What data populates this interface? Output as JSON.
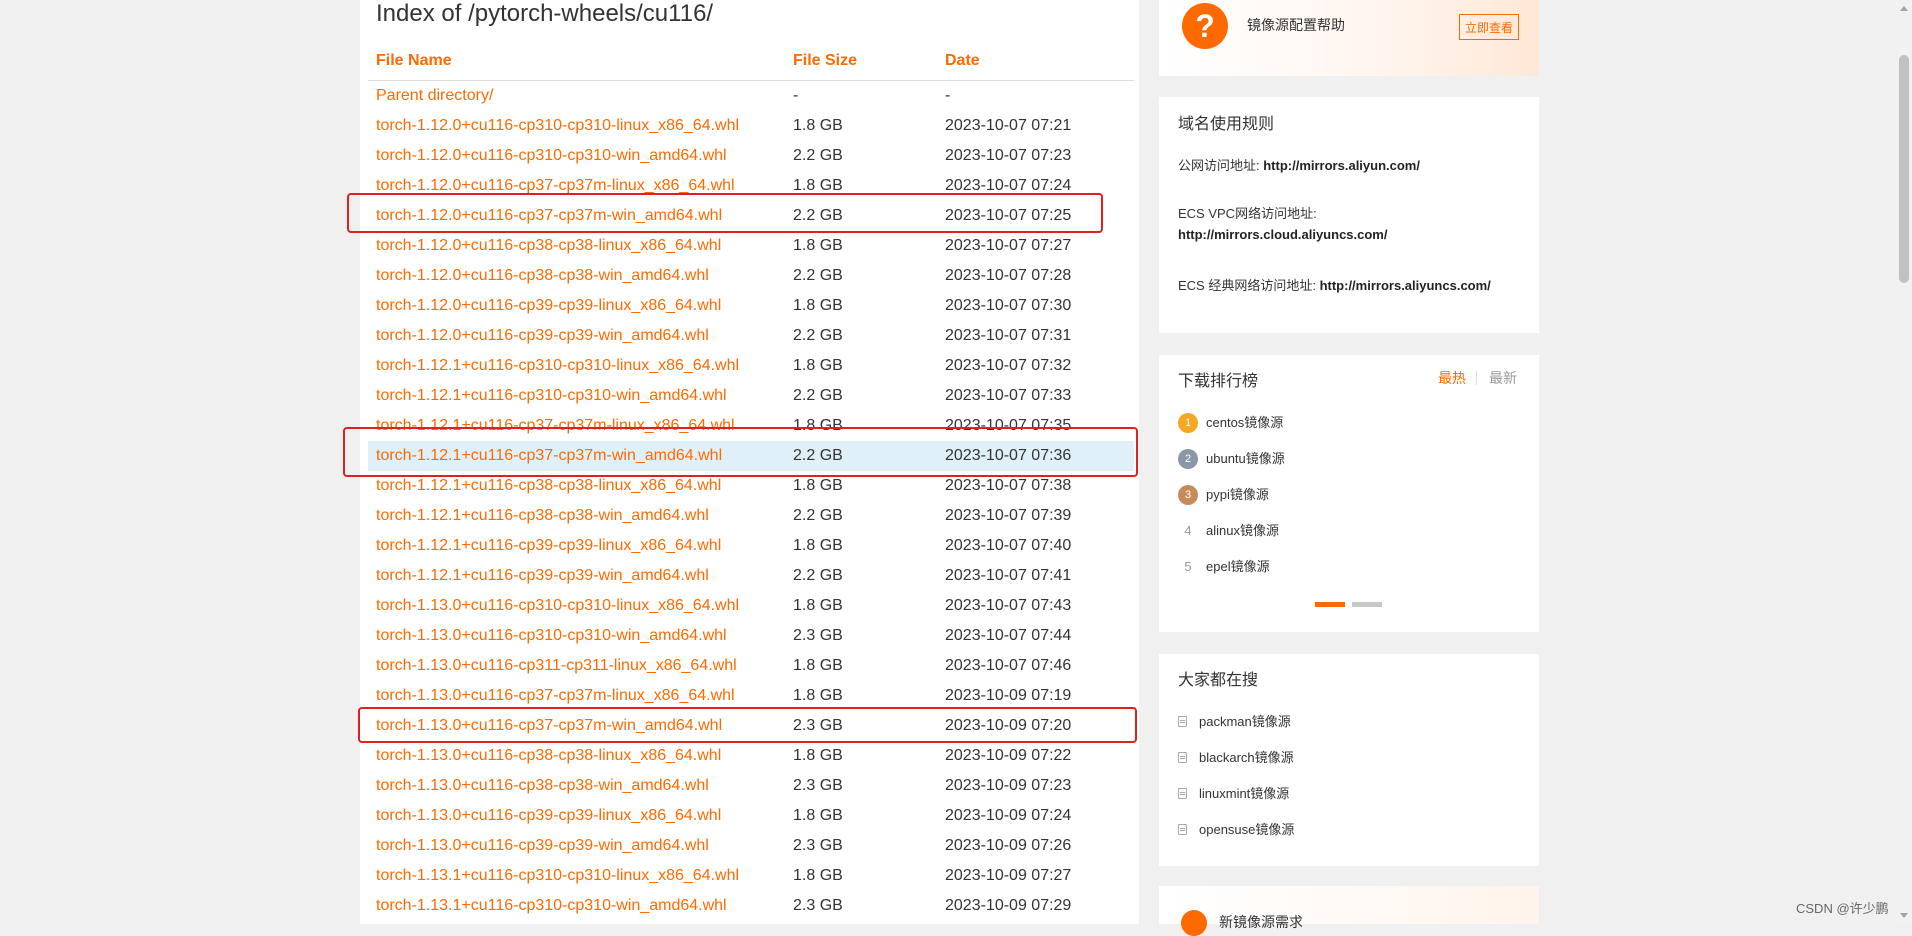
{
  "page_title": "Index of /pytorch-wheels/cu116/",
  "columns": {
    "name": "File Name",
    "size": "File Size",
    "date": "Date"
  },
  "files": [
    {
      "name": "Parent directory/",
      "size": "-",
      "date": "-"
    },
    {
      "name": "torch-1.12.0+cu116-cp310-cp310-linux_x86_64.whl",
      "size": "1.8 GB",
      "date": "2023-10-07 07:21"
    },
    {
      "name": "torch-1.12.0+cu116-cp310-cp310-win_amd64.whl",
      "size": "2.2 GB",
      "date": "2023-10-07 07:23"
    },
    {
      "name": "torch-1.12.0+cu116-cp37-cp37m-linux_x86_64.whl",
      "size": "1.8 GB",
      "date": "2023-10-07 07:24"
    },
    {
      "name": "torch-1.12.0+cu116-cp37-cp37m-win_amd64.whl",
      "size": "2.2 GB",
      "date": "2023-10-07 07:25"
    },
    {
      "name": "torch-1.12.0+cu116-cp38-cp38-linux_x86_64.whl",
      "size": "1.8 GB",
      "date": "2023-10-07 07:27"
    },
    {
      "name": "torch-1.12.0+cu116-cp38-cp38-win_amd64.whl",
      "size": "2.2 GB",
      "date": "2023-10-07 07:28"
    },
    {
      "name": "torch-1.12.0+cu116-cp39-cp39-linux_x86_64.whl",
      "size": "1.8 GB",
      "date": "2023-10-07 07:30"
    },
    {
      "name": "torch-1.12.0+cu116-cp39-cp39-win_amd64.whl",
      "size": "2.2 GB",
      "date": "2023-10-07 07:31"
    },
    {
      "name": "torch-1.12.1+cu116-cp310-cp310-linux_x86_64.whl",
      "size": "1.8 GB",
      "date": "2023-10-07 07:32"
    },
    {
      "name": "torch-1.12.1+cu116-cp310-cp310-win_amd64.whl",
      "size": "2.2 GB",
      "date": "2023-10-07 07:33"
    },
    {
      "name": "torch-1.12.1+cu116-cp37-cp37m-linux_x86_64.whl",
      "size": "1.8 GB",
      "date": "2023-10-07 07:35"
    },
    {
      "name": "torch-1.12.1+cu116-cp37-cp37m-win_amd64.whl",
      "size": "2.2 GB",
      "date": "2023-10-07 07:36"
    },
    {
      "name": "torch-1.12.1+cu116-cp38-cp38-linux_x86_64.whl",
      "size": "1.8 GB",
      "date": "2023-10-07 07:38"
    },
    {
      "name": "torch-1.12.1+cu116-cp38-cp38-win_amd64.whl",
      "size": "2.2 GB",
      "date": "2023-10-07 07:39"
    },
    {
      "name": "torch-1.12.1+cu116-cp39-cp39-linux_x86_64.whl",
      "size": "1.8 GB",
      "date": "2023-10-07 07:40"
    },
    {
      "name": "torch-1.12.1+cu116-cp39-cp39-win_amd64.whl",
      "size": "2.2 GB",
      "date": "2023-10-07 07:41"
    },
    {
      "name": "torch-1.13.0+cu116-cp310-cp310-linux_x86_64.whl",
      "size": "1.8 GB",
      "date": "2023-10-07 07:43"
    },
    {
      "name": "torch-1.13.0+cu116-cp310-cp310-win_amd64.whl",
      "size": "2.3 GB",
      "date": "2023-10-07 07:44"
    },
    {
      "name": "torch-1.13.0+cu116-cp311-cp311-linux_x86_64.whl",
      "size": "1.8 GB",
      "date": "2023-10-07 07:46"
    },
    {
      "name": "torch-1.13.0+cu116-cp37-cp37m-linux_x86_64.whl",
      "size": "1.8 GB",
      "date": "2023-10-09 07:19"
    },
    {
      "name": "torch-1.13.0+cu116-cp37-cp37m-win_amd64.whl",
      "size": "2.3 GB",
      "date": "2023-10-09 07:20"
    },
    {
      "name": "torch-1.13.0+cu116-cp38-cp38-linux_x86_64.whl",
      "size": "1.8 GB",
      "date": "2023-10-09 07:22"
    },
    {
      "name": "torch-1.13.0+cu116-cp38-cp38-win_amd64.whl",
      "size": "2.3 GB",
      "date": "2023-10-09 07:23"
    },
    {
      "name": "torch-1.13.0+cu116-cp39-cp39-linux_x86_64.whl",
      "size": "1.8 GB",
      "date": "2023-10-09 07:24"
    },
    {
      "name": "torch-1.13.0+cu116-cp39-cp39-win_amd64.whl",
      "size": "2.3 GB",
      "date": "2023-10-09 07:26"
    },
    {
      "name": "torch-1.13.1+cu116-cp310-cp310-linux_x86_64.whl",
      "size": "1.8 GB",
      "date": "2023-10-09 07:27"
    },
    {
      "name": "torch-1.13.1+cu116-cp310-cp310-win_amd64.whl",
      "size": "2.3 GB",
      "date": "2023-10-09 07:29"
    }
  ],
  "hovered_row_index": 12,
  "annotated_row_indices": [
    4,
    12,
    21
  ],
  "annotation_color": "#e02020",
  "accent_color": "#ff6a00",
  "sidebar": {
    "promo": {
      "icon": "question-icon",
      "icon_text": "?",
      "text": "镜像源配置帮助",
      "button": "立即查看"
    },
    "rules": {
      "title": "域名使用规则",
      "public_label": "公网访问地址: ",
      "public_url": "http://mirrors.aliyun.com/",
      "vpc_label": "ECS VPC网络访问地址:",
      "vpc_url": "http://mirrors.cloud.aliyuncs.com/",
      "classic_label": "ECS 经典网络访问地址: ",
      "classic_url": "http://mirrors.aliyuncs.com/"
    },
    "ranking": {
      "title": "下载排行榜",
      "tab_hot": "最热",
      "tab_new": "最新",
      "items": [
        {
          "rank": "1",
          "label": "centos镜像源",
          "badge": "gold"
        },
        {
          "rank": "2",
          "label": "ubuntu镜像源",
          "badge": "silver"
        },
        {
          "rank": "3",
          "label": "pypi镜像源",
          "badge": "bronze"
        },
        {
          "rank": "4",
          "label": "alinux镜像源"
        },
        {
          "rank": "5",
          "label": "epel镜像源"
        }
      ]
    },
    "popular": {
      "title": "大家都在搜",
      "items": [
        "packman镜像源",
        "blackarch镜像源",
        "linuxmint镜像源",
        "opensuse镜像源"
      ]
    },
    "bottom_card": {
      "text": "新镜像源需求"
    }
  },
  "watermark": "CSDN @许少鹏"
}
